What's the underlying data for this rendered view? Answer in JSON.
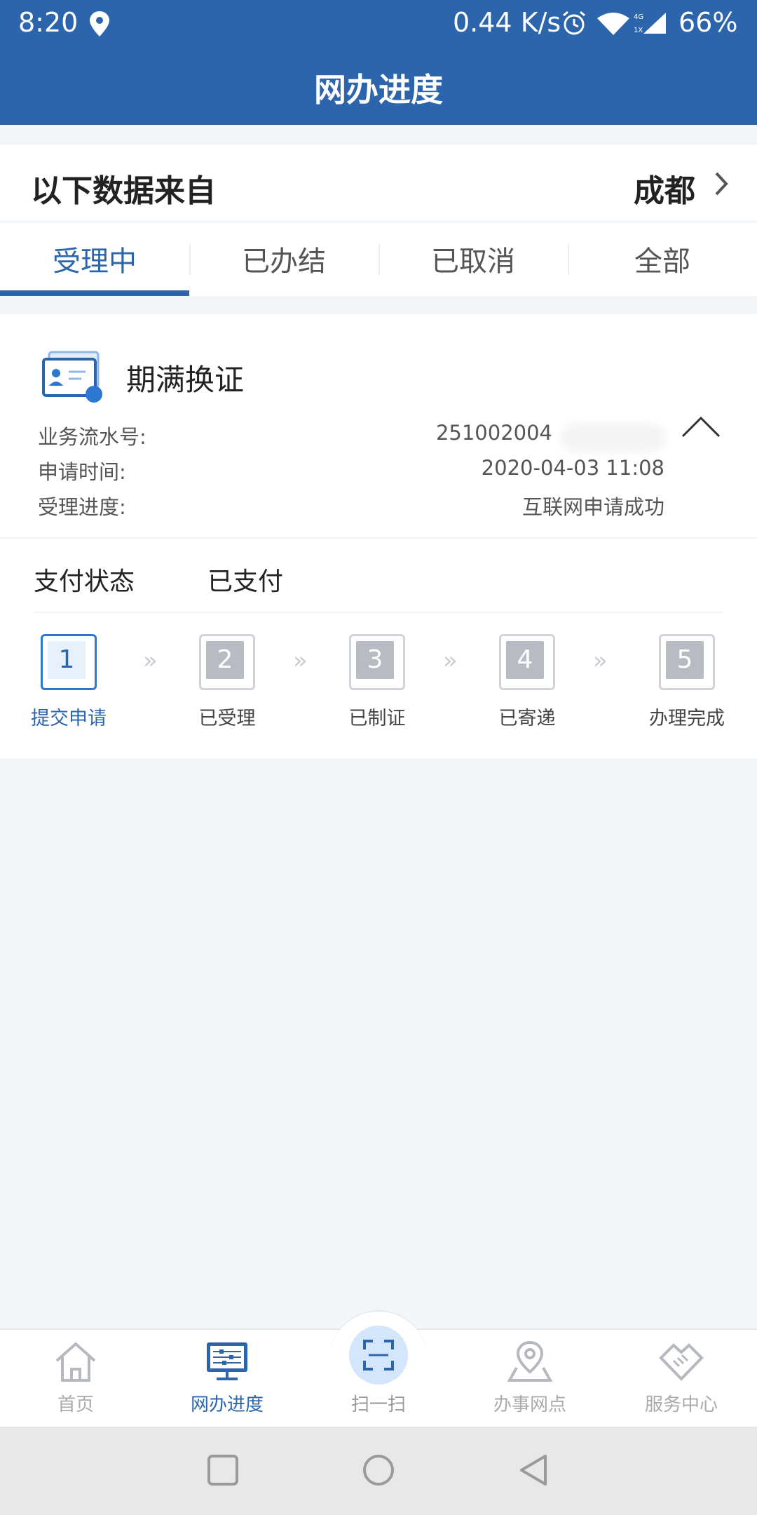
{
  "status_bar": {
    "time": "8:20",
    "net_speed": "0.44 K/s",
    "battery": "66%",
    "icons": [
      "location-icon",
      "alarm-icon",
      "wifi-icon",
      "signal-icon"
    ]
  },
  "header": {
    "title": "网办进度"
  },
  "source": {
    "label": "以下数据来自",
    "city": "成都"
  },
  "tabs": [
    {
      "label": "受理中",
      "active": true
    },
    {
      "label": "已办结",
      "active": false
    },
    {
      "label": "已取消",
      "active": false
    },
    {
      "label": "全部",
      "active": false
    }
  ],
  "card": {
    "title": "期满换证",
    "rows": [
      {
        "label": "业务流水号:",
        "value": "251002004"
      },
      {
        "label": "申请时间:",
        "value": "2020-04-03 11:08"
      },
      {
        "label": "受理进度:",
        "value": "互联网申请成功"
      }
    ],
    "payment": {
      "label": "支付状态",
      "value": "已支付"
    },
    "steps": [
      {
        "num": "1",
        "label": "提交申请",
        "active": true
      },
      {
        "num": "2",
        "label": "已受理",
        "active": false
      },
      {
        "num": "3",
        "label": "已制证",
        "active": false
      },
      {
        "num": "4",
        "label": "已寄递",
        "active": false
      },
      {
        "num": "5",
        "label": "办理完成",
        "active": false
      }
    ],
    "step_separator": "»"
  },
  "bottom_nav": [
    {
      "label": "首页",
      "icon": "home-icon",
      "active": false
    },
    {
      "label": "网办进度",
      "icon": "monitor-icon",
      "active": true
    },
    {
      "label": "扫一扫",
      "icon": "scan-icon",
      "active": false
    },
    {
      "label": "办事网点",
      "icon": "map-pin-icon",
      "active": false
    },
    {
      "label": "服务中心",
      "icon": "handshake-icon",
      "active": false
    }
  ],
  "colors": {
    "primary": "#2c65ac",
    "background": "#f3f6f9",
    "muted": "#aaaaaa"
  }
}
